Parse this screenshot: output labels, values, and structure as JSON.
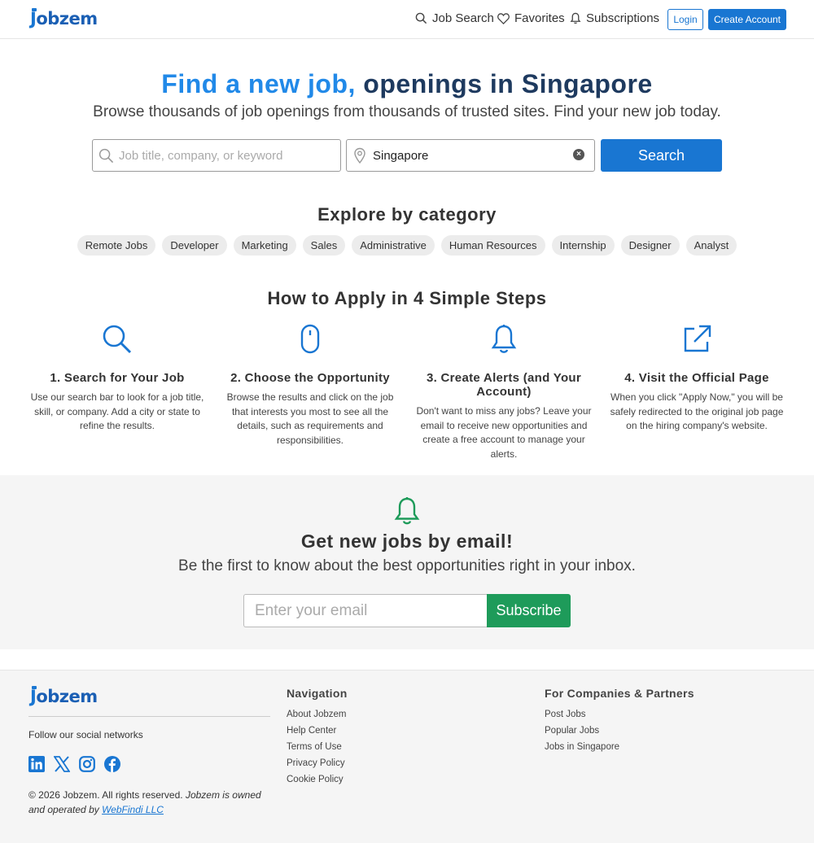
{
  "brand": {
    "name": "Jobzem",
    "color": "#1976d2"
  },
  "header": {
    "nav": [
      {
        "label": "Job Search",
        "icon": "search-icon"
      },
      {
        "label": "Favorites",
        "icon": "heart-icon"
      },
      {
        "label": "Subscriptions",
        "icon": "bell-icon"
      }
    ],
    "login_label": "Login",
    "create_account_label": "Create Account"
  },
  "hero": {
    "title_accent": "Find a new job,",
    "title_rest": " openings in Singapore",
    "subtitle": "Browse thousands of job openings from thousands of trusted sites. Find your new job today."
  },
  "search": {
    "keyword_placeholder": "Job title, company, or keyword",
    "keyword_value": "",
    "location_value": "Singapore",
    "button_label": "Search"
  },
  "categories": {
    "heading": "Explore by category",
    "items": [
      "Remote Jobs",
      "Developer",
      "Marketing",
      "Sales",
      "Administrative",
      "Human Resources",
      "Internship",
      "Designer",
      "Analyst"
    ]
  },
  "steps": {
    "heading": "How to Apply in 4 Simple Steps",
    "items": [
      {
        "icon": "search-icon",
        "title": "1. Search for Your Job",
        "text": "Use our search bar to look for a job title, skill, or company. Add a city or state to refine the results."
      },
      {
        "icon": "mouse-icon",
        "title": "2. Choose the Opportunity",
        "text": "Browse the results and click on the job that interests you most to see all the details, such as requirements and responsibilities."
      },
      {
        "icon": "bell-icon",
        "title": "3. Create Alerts (and Your Account)",
        "text": "Don't want to miss any jobs? Leave your email to receive new opportunities and create a free account to manage your alerts."
      },
      {
        "icon": "external-link-icon",
        "title": "4. Visit the Official Page",
        "text": "When you click \"Apply Now,\" you will be safely redirected to the original job page on the hiring company's website."
      }
    ]
  },
  "newsletter": {
    "title": "Get new jobs by email!",
    "subtitle": "Be the first to know about the best opportunities right in your inbox.",
    "email_placeholder": "Enter your email",
    "button_label": "Subscribe",
    "button_color": "#1e9b5a"
  },
  "footer": {
    "follow_text": "Follow our social networks",
    "social": [
      "linkedin-icon",
      "x-icon",
      "instagram-icon",
      "facebook-icon"
    ],
    "copyright": "© 2026 Jobzem. All rights reserved.",
    "owner_text": "Jobzem is owned and operated by",
    "owner_link": "WebFindi LLC",
    "navigation": {
      "heading": "Navigation",
      "links": [
        "About Jobzem",
        "Help Center",
        "Terms of Use",
        "Privacy Policy",
        "Cookie Policy"
      ]
    },
    "partners": {
      "heading": "For Companies & Partners",
      "links": [
        "Post Jobs",
        "Popular Jobs",
        "Jobs in Singapore"
      ]
    }
  }
}
